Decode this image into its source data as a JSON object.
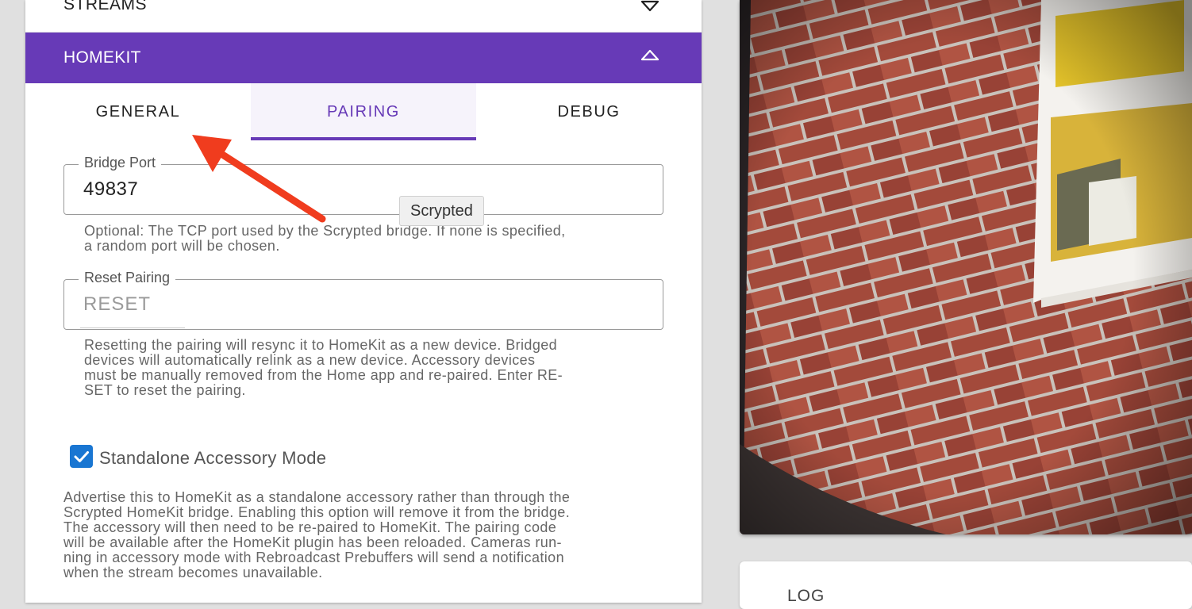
{
  "streams_section": {
    "title": "STREAMS"
  },
  "homekit_section": {
    "title": "HOMEKIT"
  },
  "tabs": [
    {
      "label": "GENERAL",
      "active": false
    },
    {
      "label": "PAIRING",
      "active": true
    },
    {
      "label": "DEBUG",
      "active": false
    }
  ],
  "bridge_port": {
    "label": "Bridge Port",
    "value": "49837",
    "hint_lines": [
      "Optional: The TCP port used by the Scrypted bridge. If none is specified,",
      "a random port will be chosen."
    ]
  },
  "reset_pairing": {
    "label": "Reset Pairing",
    "placeholder": "RESET",
    "hint_lines": [
      "Resetting the pairing will resync it to HomeKit as a new device. Bridged",
      "devices will automatically relink as a new device. Accessory devices",
      "must be manually removed from the Home app and re-paired. Enter RE-",
      "SET to reset the pairing."
    ]
  },
  "standalone": {
    "label": "Standalone Accessory Mode",
    "checked": true,
    "description_lines": [
      "Advertise this to HomeKit as a standalone accessory rather than through the",
      "Scrypted HomeKit bridge. Enabling this option will remove it from the bridge.",
      "The accessory will then need to be re-paired to HomeKit. The pairing code",
      "will be available after the HomeKit plugin has been reloaded. Cameras run-",
      "ning in accessory mode with Rebroadcast Prebuffers will send a notification",
      "when the stream becomes unavailable."
    ]
  },
  "tooltip": {
    "text": "Scrypted"
  },
  "log_section": {
    "title": "LOG"
  },
  "colors": {
    "accent": "#673ab7",
    "checkbox": "#1976d2",
    "annotation_arrow": "#f03c1e",
    "background": "#e0e0e0"
  },
  "icons": {
    "streams_chevron": "chevron-down-icon",
    "homekit_chevron": "chevron-up-icon",
    "checkbox": "check-icon",
    "annotation": "red-arrow-icon"
  }
}
